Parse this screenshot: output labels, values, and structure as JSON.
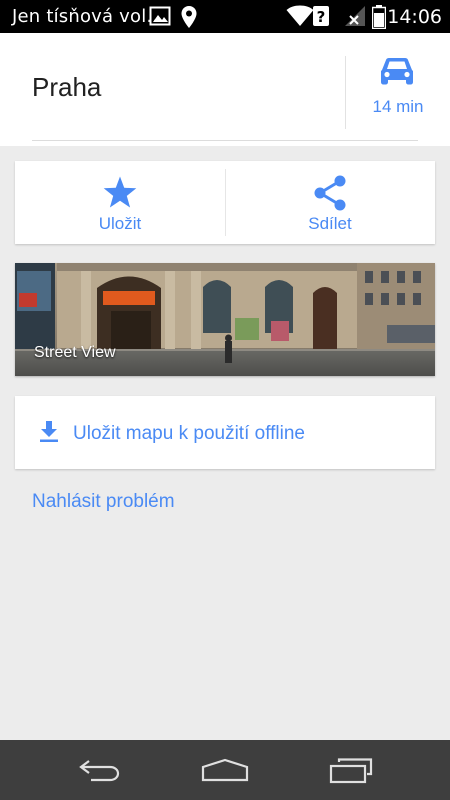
{
  "status_bar": {
    "notification_text": "Jen tísňová vol...",
    "time": "14:06"
  },
  "place": {
    "title": "Praha",
    "travel_time": "14 min",
    "travel_mode_icon": "car-icon"
  },
  "actions": {
    "save_label": "Uložit",
    "share_label": "Sdílet"
  },
  "street_view": {
    "label": "Street View"
  },
  "offline": {
    "label": "Uložit mapu k použití offline"
  },
  "report": {
    "label": "Nahlásit problém"
  },
  "colors": {
    "accent": "#4a8af4",
    "background": "#ececec",
    "status_bar": "#000000",
    "nav_bar": "#3e3e3e"
  }
}
